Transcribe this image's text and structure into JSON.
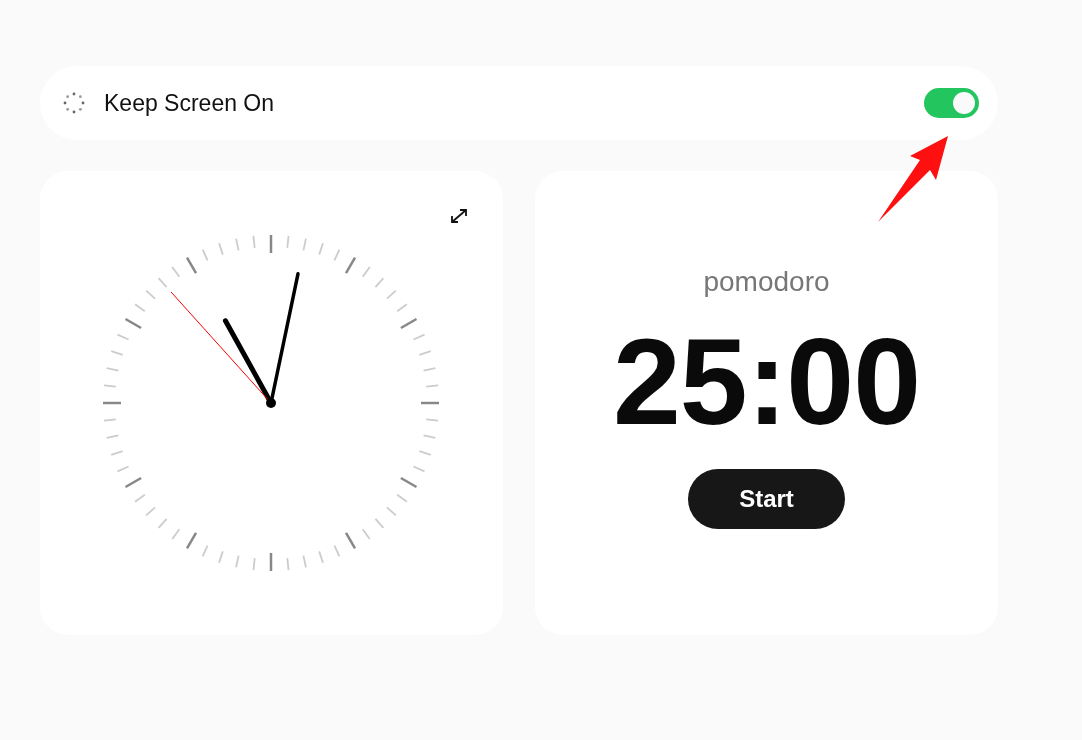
{
  "settings_bar": {
    "label": "Keep Screen On",
    "on": true
  },
  "pomodoro": {
    "mode": "pomodoro",
    "time": "25:00",
    "button": "Start"
  }
}
